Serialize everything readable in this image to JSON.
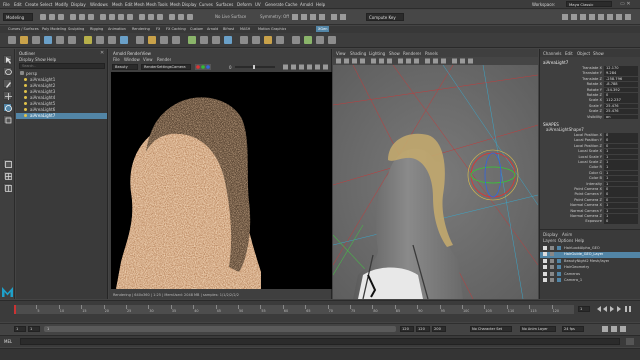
{
  "menubar": {
    "items": [
      "File",
      "Edit",
      "Create",
      "Select",
      "Modify",
      "Display",
      "Windows",
      "Mesh",
      "Edit Mesh",
      "Mesh Tools",
      "Mesh Display",
      "Curves",
      "Surfaces",
      "Deform",
      "UV",
      "Generate",
      "Cache",
      "Arnold",
      "Help"
    ],
    "workspace_label": "Workspace:",
    "workspace_value": "Maya Classic"
  },
  "statusline": {
    "mode": "Modeling",
    "no_live_surface": "No Live Surface",
    "symmetry": "Symmetry: Off",
    "render_setup": "Compute Key"
  },
  "shelf": {
    "tabs": [
      "Curves / Surfaces",
      "Poly Modeling",
      "Sculpting",
      "Rigging",
      "Animation",
      "Rendering",
      "FX",
      "FX Caching",
      "Custom",
      "Arnold",
      "Bifrost",
      "MASH",
      "Motion Graphics",
      "XGen"
    ],
    "active_tab": "XGen"
  },
  "outliner": {
    "title": "Outliner",
    "menu": [
      "Display",
      "Show",
      "Help"
    ],
    "search_placeholder": "Search...",
    "items": [
      "persp",
      "aiAreaLight1",
      "aiAreaLight2",
      "aiAreaLight3",
      "aiAreaLight4",
      "aiAreaLight5",
      "aiAreaLight6",
      "aiAreaLight7"
    ],
    "selected_index": 7
  },
  "renderview": {
    "title": "Arnold RenderView",
    "menu": [
      "File",
      "Window",
      "View",
      "Render"
    ],
    "camera": "Beauty",
    "aov": "RenderSettingsCamera",
    "exposure": "0",
    "status_text": "Rendering | 640x360 | 1:25 | MemUsed: 2048 MB | samples: 1/1/2/2/2/2"
  },
  "viewport": {
    "menu": [
      "View",
      "Shading",
      "Lighting",
      "Show",
      "Renderer",
      "Panels"
    ]
  },
  "channelbox": {
    "tabs": [
      "Channels",
      "Edit",
      "Object",
      "Show"
    ],
    "object_name": "aiAreaLight7",
    "channels": [
      {
        "name": "Translate X",
        "value": "12.170"
      },
      {
        "name": "Translate Y",
        "value": "9.284"
      },
      {
        "name": "Translate Z",
        "value": "-258.796"
      },
      {
        "name": "Rotate X",
        "value": "-8.788"
      },
      {
        "name": "Rotate Y",
        "value": "-54.392"
      },
      {
        "name": "Rotate Z",
        "value": "0"
      },
      {
        "name": "Scale X",
        "value": "112.237"
      },
      {
        "name": "Scale Y",
        "value": "25.476"
      },
      {
        "name": "Scale Z",
        "value": "25.476"
      },
      {
        "name": "Visibility",
        "value": "on"
      }
    ],
    "shapes_label": "SHAPES",
    "shape_name": "aiAreaLightShape7",
    "shape_channels": [
      {
        "name": "Local Position X",
        "value": "0"
      },
      {
        "name": "Local Position Y",
        "value": "0"
      },
      {
        "name": "Local Position Z",
        "value": "0"
      },
      {
        "name": "Local Scale X",
        "value": "1"
      },
      {
        "name": "Local Scale Y",
        "value": "1"
      },
      {
        "name": "Local Scale Z",
        "value": "1"
      },
      {
        "name": "Color R",
        "value": "1"
      },
      {
        "name": "Color G",
        "value": "1"
      },
      {
        "name": "Color B",
        "value": "1"
      },
      {
        "name": "Intensity",
        "value": "1"
      },
      {
        "name": "Point Camera X",
        "value": "0"
      },
      {
        "name": "Point Camera Y",
        "value": "0"
      },
      {
        "name": "Point Camera Z",
        "value": "0"
      },
      {
        "name": "Normal Camera X",
        "value": "1"
      },
      {
        "name": "Normal Camera Y",
        "value": "1"
      },
      {
        "name": "Normal Camera Z",
        "value": "1"
      },
      {
        "name": "Exposure",
        "value": "0"
      }
    ],
    "layer_tabs": [
      "Display",
      "Anim"
    ],
    "layer_menu": [
      "Layers",
      "Options",
      "Help"
    ],
    "layers": [
      "HairLookAlpha_GEO",
      "HairGuide_GEO_Layer",
      "BeautyNight2 Mesh/layer",
      "HairGeometry",
      "Cameras",
      "Camera_1"
    ],
    "selected_layer": 1
  },
  "timeline": {
    "ticks": [
      "5",
      "10",
      "15",
      "20",
      "25",
      "30",
      "35",
      "40",
      "45",
      "50",
      "55",
      "60",
      "65",
      "70",
      "75",
      "80",
      "85",
      "90",
      "95",
      "100",
      "105",
      "110",
      "115",
      "120"
    ],
    "current_frame": "1"
  },
  "rangebar": {
    "start": "1",
    "inner_start": "1",
    "inner_end": "120",
    "end": "120",
    "end2": "200",
    "character_set": "No Character Set",
    "anim_layer": "No Anim Layer",
    "fps": "24 fps"
  },
  "cmdline": {
    "label": "MEL"
  }
}
